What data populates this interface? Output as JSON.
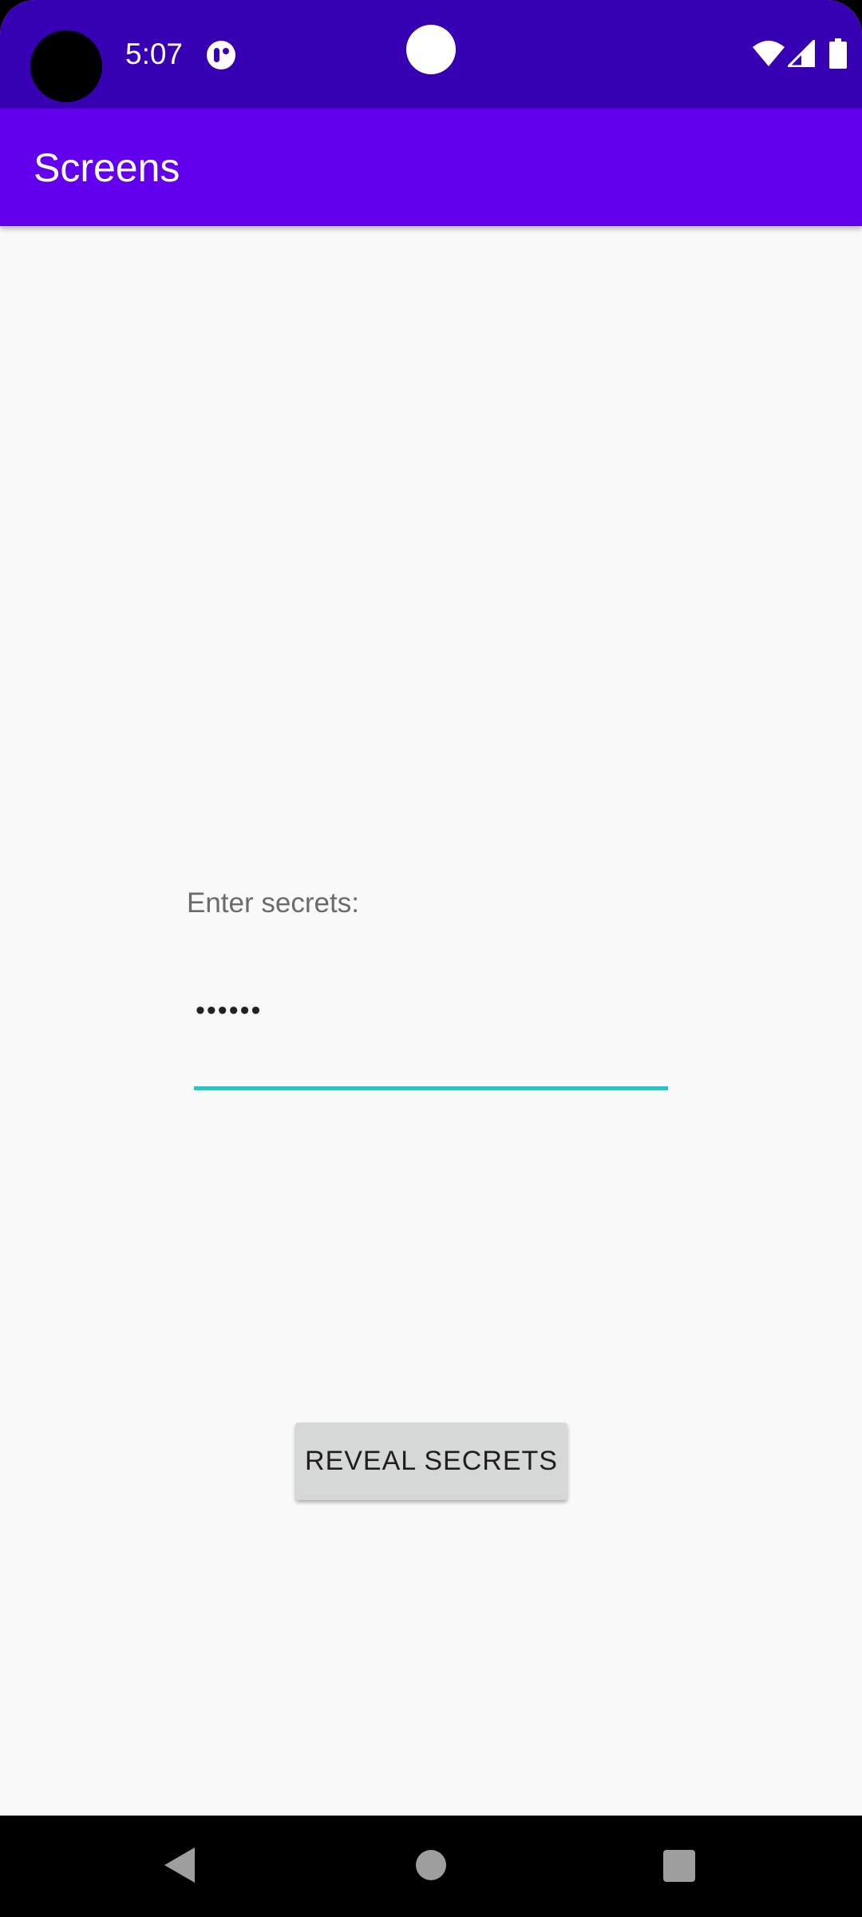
{
  "status_bar": {
    "time": "5:07",
    "app_icon": "notification-app-icon",
    "icons": [
      "wifi-icon",
      "signal-icon",
      "battery-icon"
    ]
  },
  "app_bar": {
    "title": "Screens"
  },
  "main": {
    "prompt_label": "Enter secrets:",
    "password_field": {
      "masked_value": "••••••"
    },
    "reveal_button_label": "REVEAL SECRETS"
  },
  "nav_bar": {
    "buttons": [
      "back-icon",
      "home-icon",
      "recents-icon"
    ]
  },
  "colors": {
    "status_bar": "#3700b3",
    "app_bar": "#6200ee",
    "accent_underline": "#26c6c6",
    "button_bg": "#d6d7d7",
    "background": "#f9f9f9"
  }
}
